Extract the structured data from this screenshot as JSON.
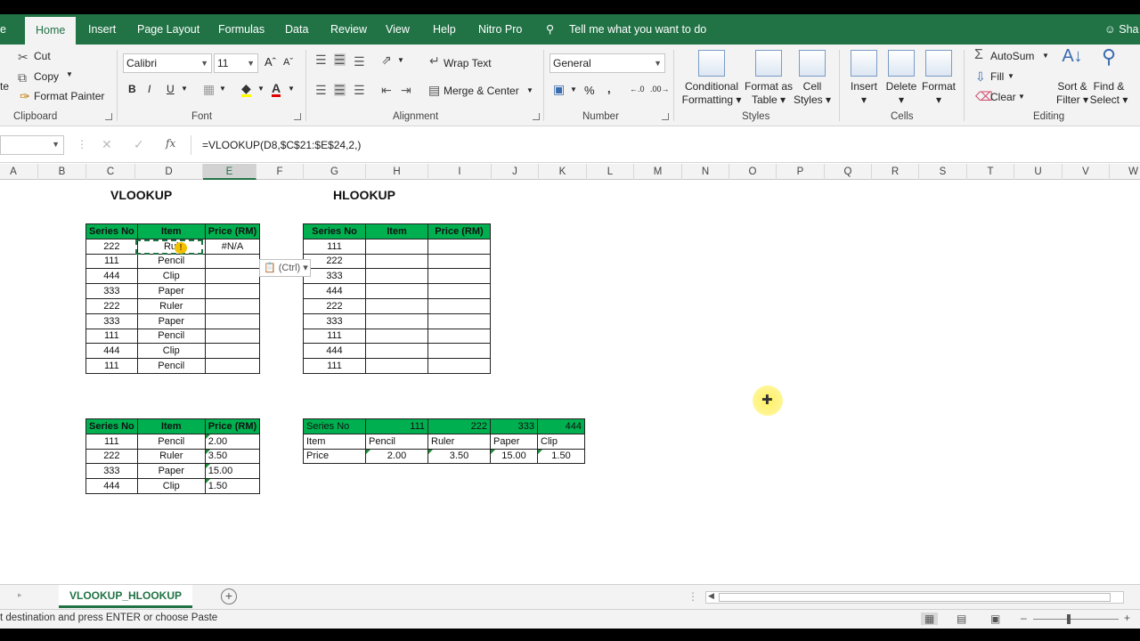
{
  "tabs": [
    "Home",
    "Insert",
    "Page Layout",
    "Formulas",
    "Data",
    "Review",
    "View",
    "Help",
    "Nitro Pro"
  ],
  "tell_me": "Tell me what you want to do",
  "share": "Sha",
  "clipboard": {
    "cut": "Cut",
    "copy": "Copy",
    "format_painter": "Format Painter",
    "paste_frag": "te",
    "label": "Clipboard"
  },
  "font": {
    "name": "Calibri",
    "size": "11",
    "label": "Font",
    "bold": "B",
    "italic": "I",
    "underline": "U"
  },
  "alignment": {
    "wrap": "Wrap Text",
    "merge": "Merge & Center",
    "label": "Alignment"
  },
  "number": {
    "format": "General",
    "label": "Number",
    "percent": "%",
    "comma": ","
  },
  "styles": {
    "conditional": [
      "Conditional",
      "Formatting"
    ],
    "format_table": [
      "Format as",
      "Table"
    ],
    "cell_styles": [
      "Cell",
      "Styles"
    ],
    "label": "Styles"
  },
  "cells": {
    "insert": "Insert",
    "delete": "Delete",
    "format": "Format",
    "label": "Cells"
  },
  "editing": {
    "autosum": "AutoSum",
    "fill": "Fill",
    "clear": "Clear",
    "sort": [
      "Sort &",
      "Filter"
    ],
    "find": [
      "Find &",
      "Select"
    ],
    "label": "Editing"
  },
  "formula": "=VLOOKUP(D8,$C$21:$E$24,2,)",
  "fx_label": "fx",
  "columns": [
    "A",
    "B",
    "C",
    "D",
    "E",
    "F",
    "G",
    "H",
    "I",
    "J",
    "K",
    "L",
    "M",
    "N",
    "O",
    "P",
    "Q",
    "R",
    "S",
    "T",
    "U",
    "V",
    "W"
  ],
  "vlookup_title": "VLOOKUP",
  "hlookup_title": "HLOOKUP",
  "vtable": {
    "headers": [
      "Series No",
      "Item",
      "Price (RM)"
    ],
    "rows": [
      [
        "222",
        "Rul",
        "#N/A"
      ],
      [
        "111",
        "Pencil",
        ""
      ],
      [
        "444",
        "Clip",
        ""
      ],
      [
        "333",
        "Paper",
        ""
      ],
      [
        "222",
        "Ruler",
        ""
      ],
      [
        "333",
        "Paper",
        ""
      ],
      [
        "111",
        "Pencil",
        ""
      ],
      [
        "444",
        "Clip",
        ""
      ],
      [
        "111",
        "Pencil",
        ""
      ]
    ]
  },
  "htable": {
    "headers": [
      "Series No",
      "Item",
      "Price (RM)"
    ],
    "rows": [
      [
        "111"
      ],
      [
        "222"
      ],
      [
        "333"
      ],
      [
        "444"
      ],
      [
        "222"
      ],
      [
        "333"
      ],
      [
        "111"
      ],
      [
        "444"
      ],
      [
        "111"
      ]
    ]
  },
  "vref": {
    "headers": [
      "Series No",
      "Item",
      "Price (RM)"
    ],
    "rows": [
      [
        "111",
        "Pencil",
        "2.00"
      ],
      [
        "222",
        "Ruler",
        "3.50"
      ],
      [
        "333",
        "Paper",
        "15.00"
      ],
      [
        "444",
        "Clip",
        "1.50"
      ]
    ]
  },
  "href": {
    "row1": [
      "Series No",
      "111",
      "222",
      "333",
      "444"
    ],
    "row2": [
      "Item",
      "Pencil",
      "Ruler",
      "Paper",
      "Clip"
    ],
    "row3": [
      "Price",
      "2.00",
      "3.50",
      "15.00",
      "1.50"
    ]
  },
  "ctrl_label": "(Ctrl)",
  "sheet_tab": "VLOOKUP_HLOOKUP",
  "status_msg": "t destination and press ENTER or choose Paste",
  "colors": {
    "excel_green": "#217346",
    "header_green": "#00b050"
  }
}
